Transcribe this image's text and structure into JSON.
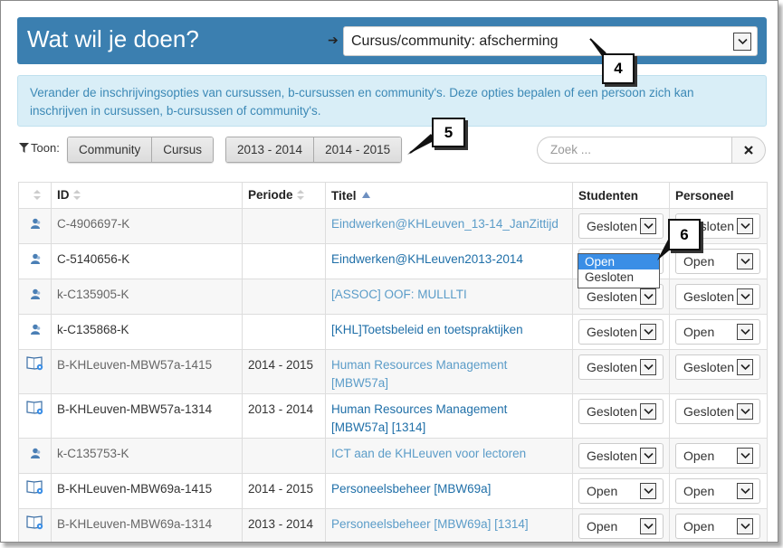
{
  "header": {
    "title": "Wat wil je doen?",
    "arrow": "➔",
    "select_value": "Cursus/community: afscherming"
  },
  "info": {
    "text": "Verander de inschrijvingsopties van cursussen, b-cursussen en community's. Deze opties bepalen of een persoon zich kan inschrijven in cursussen, b-cursussen of community's."
  },
  "filter": {
    "label": "Toon:",
    "type_buttons": [
      "Community",
      "Cursus"
    ],
    "period_buttons": [
      "2013 - 2014",
      "2014 - 2015"
    ]
  },
  "search": {
    "placeholder": "Zoek ..."
  },
  "callouts": [
    "4",
    "5",
    "6"
  ],
  "table": {
    "headers": [
      "",
      "ID",
      "Periode",
      "Titel",
      "Studenten",
      "Personeel"
    ],
    "rows": [
      {
        "icon": "community-icon",
        "id": "C-4906697-K",
        "period": "",
        "title": "Eindwerken@KHLeuven_13-14_JanZittijd",
        "students": "Gesloten",
        "staff": "Gesloten"
      },
      {
        "icon": "community-icon",
        "id": "C-5140656-K",
        "period": "",
        "title": "Eindwerken@KHLeuven2013-2014",
        "students": "Open",
        "staff": "Open"
      },
      {
        "icon": "community-icon",
        "id": "k-C135905-K",
        "period": "",
        "title": "[ASSOC] OOF: MULLLTI",
        "students": "Gesloten",
        "staff": "Gesloten"
      },
      {
        "icon": "community-icon",
        "id": "k-C135868-K",
        "period": "",
        "title": "[KHL]Toetsbeleid en toetspraktijken",
        "students": "Gesloten",
        "staff": "Open"
      },
      {
        "icon": "course-book-icon",
        "id": "B-KHLeuven-MBW57a-1415",
        "period": "2014 - 2015",
        "title": "Human Resources Management [MBW57a]",
        "students": "Gesloten",
        "staff": "Gesloten"
      },
      {
        "icon": "course-book-icon",
        "id": "B-KHLeuven-MBW57a-1314",
        "period": "2013 - 2014",
        "title": "Human Resources Management [MBW57a] [1314]",
        "students": "Gesloten",
        "staff": "Gesloten"
      },
      {
        "icon": "community-icon",
        "id": "k-C135753-K",
        "period": "",
        "title": "ICT aan de KHLeuven voor lectoren",
        "students": "Gesloten",
        "staff": "Open"
      },
      {
        "icon": "course-book-icon",
        "id": "B-KHLeuven-MBW69a-1415",
        "period": "2014 - 2015",
        "title": "Personeelsbeheer [MBW69a]",
        "students": "Open",
        "staff": "Open"
      },
      {
        "icon": "course-book-icon",
        "id": "B-KHLeuven-MBW69a-1314",
        "period": "2013 - 2014",
        "title": "Personeelsbeheer [MBW69a] [1314]",
        "students": "Open",
        "staff": "Open"
      }
    ]
  },
  "dropdown_open": {
    "options": [
      "Open",
      "Gesloten"
    ],
    "highlighted": "Open"
  },
  "colors": {
    "header_bg": "#3b7fb0",
    "info_bg": "#d9eef7",
    "info_text": "#3c89b6",
    "link": "#1f6fa8",
    "highlight": "#3a8ee6"
  }
}
